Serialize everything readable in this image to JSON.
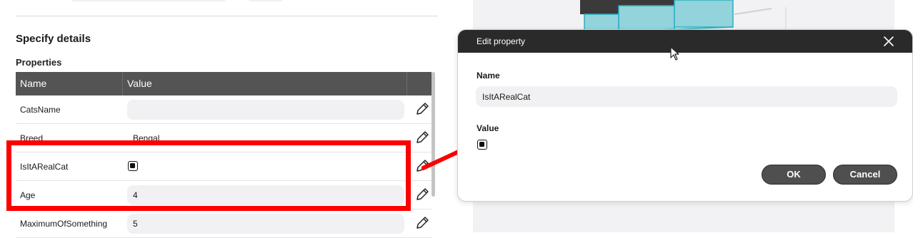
{
  "form": {
    "section_title": "Specify details",
    "subsection_title": "Properties",
    "table": {
      "headers": [
        "Name",
        "Value"
      ],
      "rows": [
        {
          "name": "CatsName",
          "value": "",
          "type": "text"
        },
        {
          "name": "Breed",
          "value": "Bengal",
          "type": "text"
        },
        {
          "name": "IsItARealCat",
          "value": "checked",
          "type": "checkbox"
        },
        {
          "name": "Age",
          "value": "4",
          "type": "text"
        },
        {
          "name": "MaximumOfSomething",
          "value": "5",
          "type": "text"
        }
      ]
    }
  },
  "dialog": {
    "title": "Edit property",
    "name_label": "Name",
    "name_value": "IsItARealCat",
    "value_label": "Value",
    "value_checked": true,
    "ok_label": "OK",
    "cancel_label": "Cancel"
  },
  "icons": {
    "edit": "pencil-icon",
    "close": "close-icon",
    "cursor": "mouse-pointer-icon"
  },
  "colors": {
    "header_bg": "#545454",
    "dialog_header_bg": "#2a2a2a",
    "highlight": "#ff0000",
    "button_bg": "#4f4f4f",
    "diagram_cell": "#93d3dc",
    "diagram_dark": "#3a3a3a"
  }
}
